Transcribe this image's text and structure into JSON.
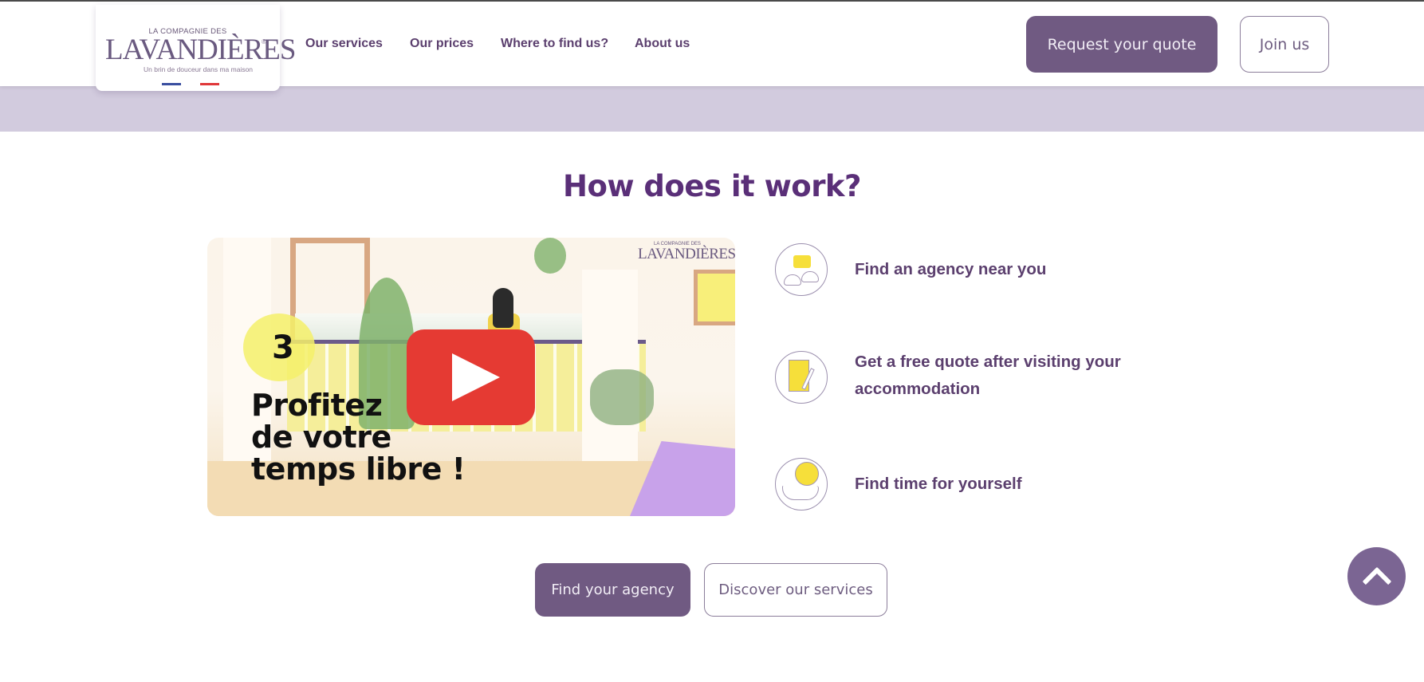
{
  "header": {
    "logo": {
      "top_line": "LA COMPAGNIE DES",
      "brand": "LAVANDIÈRES",
      "registered": "®",
      "tagline": "Un brin de douceur dans ma maison"
    },
    "nav": [
      {
        "label": "Our services"
      },
      {
        "label": "Our prices"
      },
      {
        "label": "Where to find us?"
      },
      {
        "label": "About us"
      }
    ],
    "request_quote_label": "Request your quote",
    "join_label": "Join us"
  },
  "section": {
    "title": "How does it work?",
    "video": {
      "step_number": "3",
      "caption_line1": "Profitez",
      "caption_line2": "de votre",
      "caption_line3": "temps libre !",
      "watermark_top": "LA COMPAGNIE DES",
      "watermark": "LAVANDIÈRES",
      "play_icon": "youtube-play-icon"
    },
    "steps": [
      {
        "icon": "people-chat-icon",
        "label": "Find an agency near you"
      },
      {
        "icon": "document-pen-icon",
        "label": "Get a free quote after visiting your accommodation"
      },
      {
        "icon": "smiley-hand-icon",
        "label": "Find time for yourself"
      }
    ],
    "cta": {
      "find_agency_label": "Find your agency",
      "discover_services_label": "Discover our services"
    }
  },
  "scroll_top": {
    "icon": "chevron-up-icon"
  },
  "colors": {
    "brand_purple": "#705a82",
    "title_purple": "#5a2f78",
    "band_lavender": "#d2cbde",
    "youtube_red": "#e53a33"
  }
}
